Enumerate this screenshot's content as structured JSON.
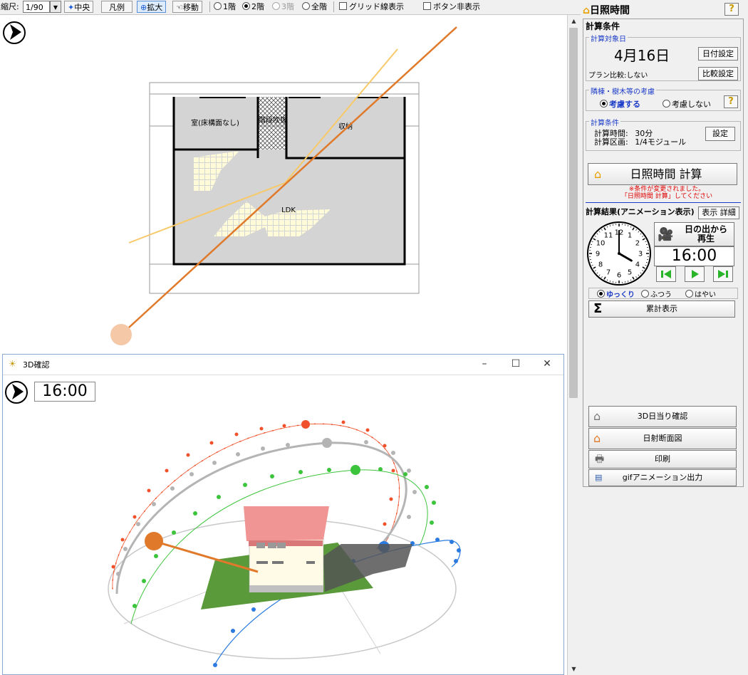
{
  "toolbar": {
    "scale_label": "縮尺:",
    "scale_value": "1/90",
    "center_label": "中央",
    "legend_label": "凡例",
    "zoom_label": "拡大",
    "move_label": "移動",
    "floor_options": [
      "1階",
      "2階",
      "3階",
      "全階"
    ],
    "floor_selected": "2階",
    "grid_label": "グリッド線表示",
    "hide_buttons_label": "ボタン非表示"
  },
  "plan": {
    "rooms": {
      "room_no_floor": "室(床構面なし)",
      "stairs": "階段吹抜",
      "storage": "収納",
      "ldk": "LDK"
    }
  },
  "window3d": {
    "title": "3D確認",
    "time": "16:00"
  },
  "panel": {
    "title": "日照時間",
    "calc_conditions_header": "計算条件",
    "target_date_group": "計算対象日",
    "target_date": "4月16日",
    "date_settings_btn": "日付設定",
    "plan_compare": "プラン比較:しない",
    "compare_settings_btn": "比較設定",
    "neighbor_group": "隣棟・樹木等の考慮",
    "consider_label": "考慮する",
    "not_consider_label": "考慮しない",
    "conditions_group": "計算条件",
    "calc_time_label": "計算時間:",
    "calc_time_value": "30分",
    "calc_area_label": "計算区画:",
    "calc_area_value": "1/4モジュール",
    "settings_btn": "設定",
    "calc_button": "日照時間 計算",
    "notice_line1": "※条件が変更されました。",
    "notice_line2": "「日照時間 計算」してください",
    "results_header": "計算結果(アニメーション表示)",
    "display_detail_btn": "表示 詳細",
    "sunrise_btn_line1": "日の出から",
    "sunrise_btn_line2": "再生",
    "time_display": "16:00",
    "speed_slow": "ゆっくり",
    "speed_normal": "ふつう",
    "speed_fast": "はやい",
    "cumulative_btn": "累計表示",
    "menu": [
      "3D日当り確認",
      "日射断面図",
      "印刷",
      "gifアニメーション出力"
    ]
  },
  "clock": {
    "numbers": [
      "12",
      "1",
      "2",
      "3",
      "4",
      "5",
      "6",
      "7",
      "8",
      "9",
      "10",
      "11"
    ],
    "hour": 4,
    "minute": 0
  }
}
